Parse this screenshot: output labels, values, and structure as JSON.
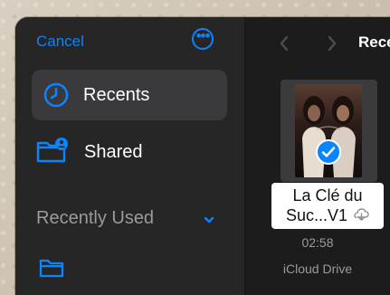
{
  "sidebar": {
    "cancel_label": "Cancel",
    "more_icon": "ellipsis-circle-icon",
    "items": [
      {
        "label": "Recents",
        "icon": "clock-icon",
        "selected": true
      },
      {
        "label": "Shared",
        "icon": "shared-folder-icon",
        "selected": false
      }
    ],
    "section": {
      "label": "Recently Used",
      "icon": "chevron-down-icon"
    }
  },
  "main": {
    "title": "Rece",
    "file": {
      "name_line_1": "La Clé du",
      "name_line_2": "Suc...V1",
      "duration": "02:58",
      "location": "iCloud Drive"
    }
  },
  "colors": {
    "accent": "#0a84ff",
    "sidebar_bg": "#262626",
    "main_bg": "#1c1c1c",
    "selected_bg": "#3a3a3c"
  }
}
